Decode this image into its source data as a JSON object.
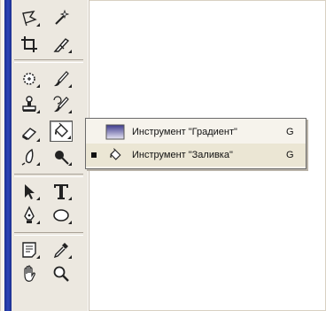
{
  "toolbox": {
    "tools": [
      {
        "icon": "lasso-icon"
      },
      {
        "icon": "magic-wand-icon"
      },
      {
        "icon": "crop-icon"
      },
      {
        "icon": "slice-icon"
      },
      {
        "icon": "healing-brush-icon"
      },
      {
        "icon": "brush-icon"
      },
      {
        "icon": "clone-stamp-icon"
      },
      {
        "icon": "history-brush-icon"
      },
      {
        "icon": "eraser-icon"
      },
      {
        "icon": "paint-bucket-icon",
        "active": true
      },
      {
        "icon": "blur-icon"
      },
      {
        "icon": "dodge-icon"
      },
      {
        "icon": "path-selection-icon"
      },
      {
        "icon": "type-icon"
      },
      {
        "icon": "pen-icon"
      },
      {
        "icon": "ellipse-icon"
      },
      {
        "icon": "notes-icon"
      },
      {
        "icon": "eyedropper-icon"
      },
      {
        "icon": "hand-icon"
      },
      {
        "icon": "zoom-icon"
      }
    ]
  },
  "flyout": {
    "items": [
      {
        "label": "Инструмент \"Градиент\"",
        "shortcut": "G",
        "icon": "gradient-icon",
        "selected": false
      },
      {
        "label": "Инструмент \"Заливка\"",
        "shortcut": "G",
        "icon": "paint-bucket-icon",
        "selected": true
      }
    ]
  },
  "colors": {
    "sidebar_blue": "#2c45b8",
    "toolbox_bg": "#ece8e0",
    "gradient_start": "#3d3a8c",
    "gradient_end": "#e8e6f4"
  }
}
